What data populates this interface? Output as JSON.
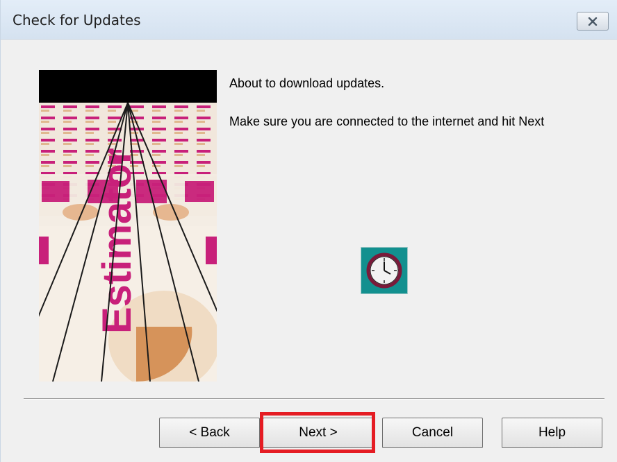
{
  "window": {
    "title": "Check for Updates",
    "close_icon": "close-x-icon"
  },
  "content": {
    "line1": "About to download updates.",
    "line2": "Make sure you are connected to the internet and hit Next",
    "status_icon": "clock-icon",
    "banner_image": "product-boxes-banner",
    "banner_text": "Estimator"
  },
  "buttons": {
    "back": "< Back",
    "next": "Next >",
    "cancel": "Cancel",
    "help": "Help"
  },
  "colors": {
    "highlight": "#e51c23",
    "icon_bg": "#12908f",
    "brand_magenta": "#c8207a"
  }
}
